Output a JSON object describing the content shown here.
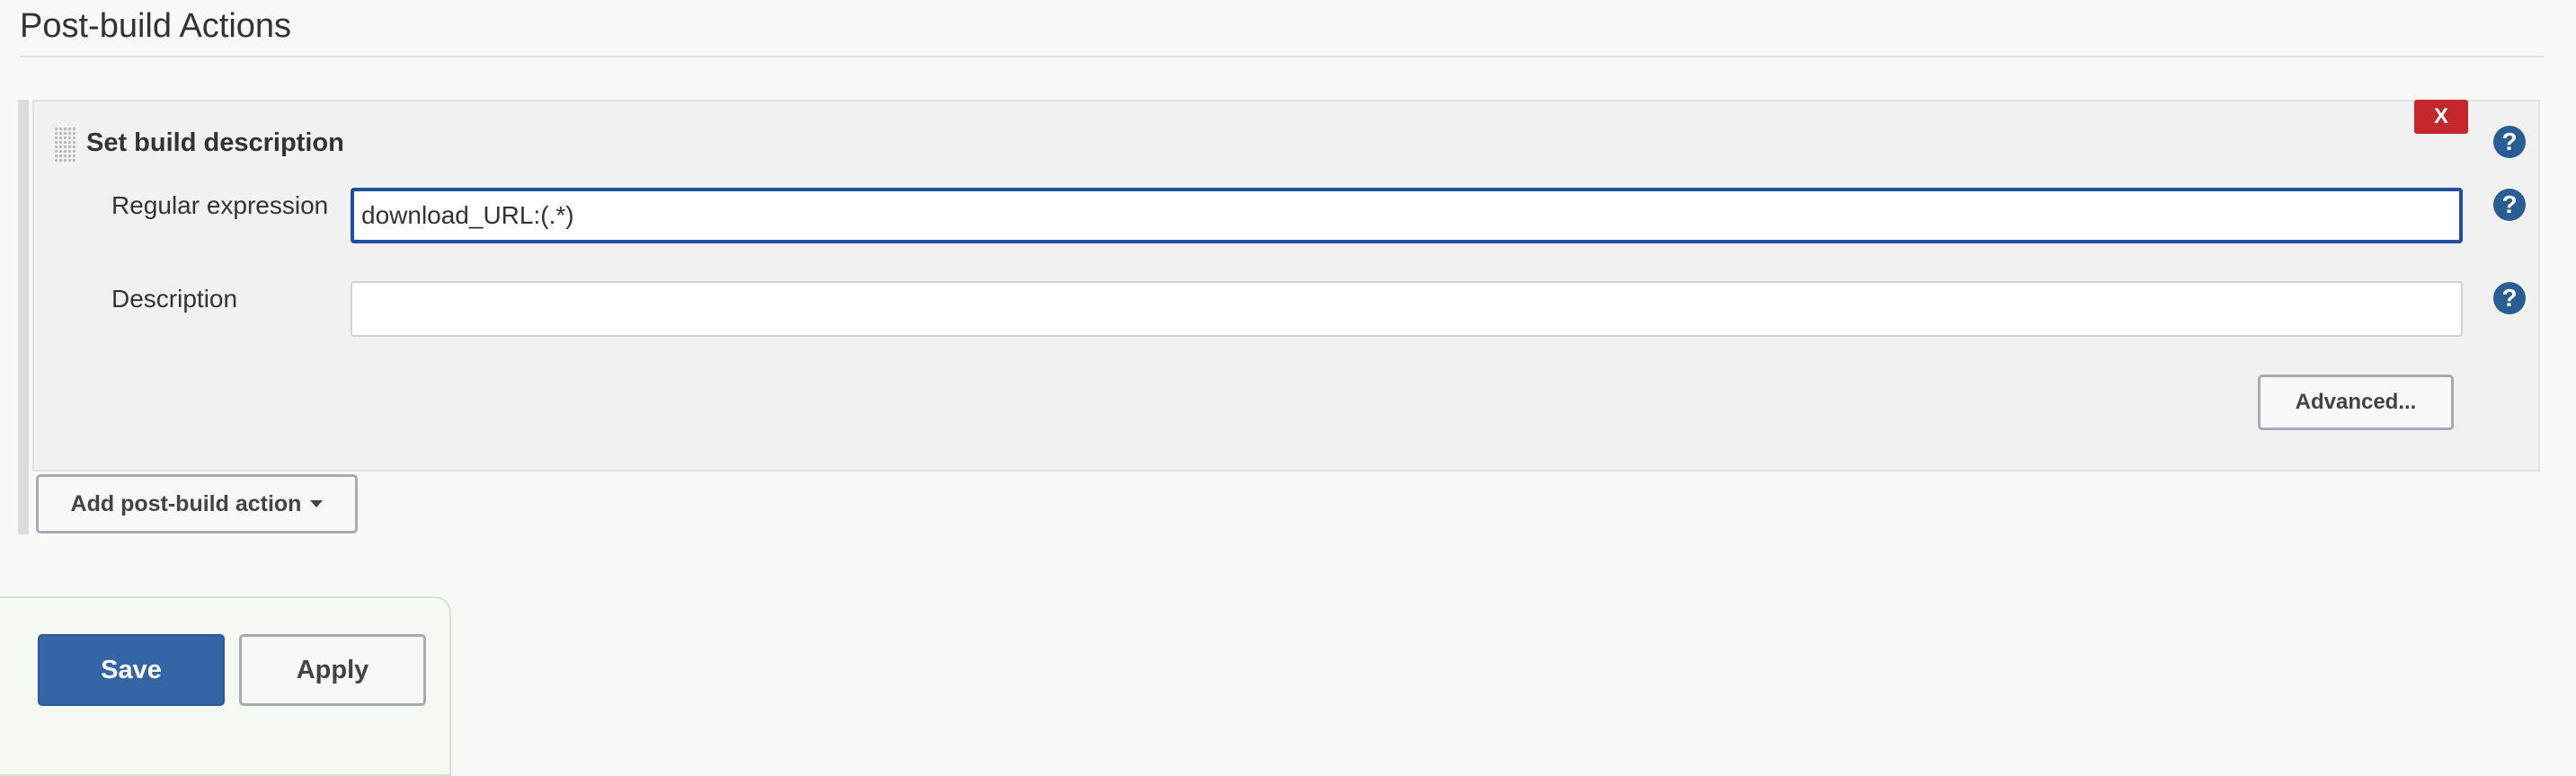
{
  "section": {
    "title": "Post-build Actions"
  },
  "builder": {
    "title": "Set build description",
    "delete_label": "X",
    "help_glyph": "?",
    "fields": [
      {
        "label": "Regular expression",
        "value": "download_URL:(.*)",
        "placeholder": ""
      },
      {
        "label": "Description",
        "value": "",
        "placeholder": ""
      }
    ],
    "advanced_label": "Advanced..."
  },
  "add_action": {
    "label": "Add post-build action"
  },
  "footer": {
    "save_label": "Save",
    "apply_label": "Apply"
  },
  "colors": {
    "primary": "#3465a4",
    "danger": "#c4282d",
    "help": "#2a5d94",
    "focus_border": "#1f4f9d"
  },
  "icons": [
    "drag-handle-icon",
    "help-icon",
    "caret-down-icon"
  ]
}
